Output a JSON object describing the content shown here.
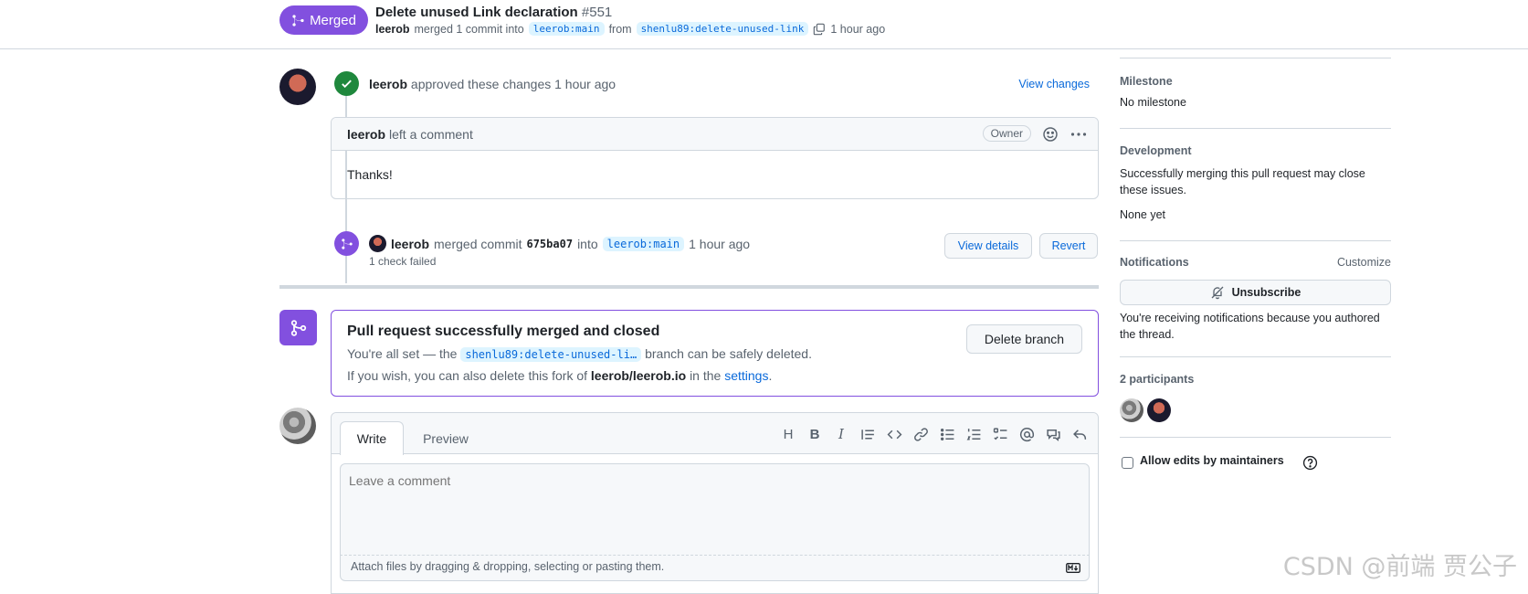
{
  "header": {
    "status": "Merged",
    "title": "Delete unused Link declaration",
    "number": "#551",
    "author": "leerob",
    "merged_text": "merged 1 commit into",
    "base_branch": "leerob:main",
    "from_text": "from",
    "head_branch": "shenlu89:delete-unused-link",
    "time": "1 hour ago"
  },
  "review": {
    "user": "leerob",
    "text": "approved these changes 1 hour ago",
    "view_changes": "View changes"
  },
  "comment": {
    "user": "leerob",
    "action": "left a comment",
    "role": "Owner",
    "body": "Thanks!"
  },
  "merge_event": {
    "user": "leerob",
    "text_a": "merged commit",
    "sha": "675ba07",
    "text_b": "into",
    "branch": "leerob:main",
    "time": "1 hour ago",
    "status": "1 check failed",
    "view_details": "View details",
    "revert": "Revert"
  },
  "merged_box": {
    "title": "Pull request successfully merged and closed",
    "line1_a": "You're all set — the",
    "branch": "shenlu89:delete-unused-li…",
    "line1_b": "branch can be safely deleted.",
    "line2_a": "If you wish, you can also delete this fork of",
    "fork": "leerob/leerob.io",
    "line2_b": "in the",
    "settings_link": "settings",
    "line2_c": ".",
    "delete_branch": "Delete branch"
  },
  "composer": {
    "tab_write": "Write",
    "tab_preview": "Preview",
    "toolbar": [
      "H",
      "B",
      "I",
      "quote-icon",
      "code-icon",
      "link-icon",
      "bulleted-list-icon",
      "numbered-list-icon",
      "task-list-icon",
      "mention-icon",
      "reference-icon",
      "reply-icon"
    ],
    "placeholder": "Leave a comment",
    "attach_text": "Attach files by dragging & dropping, selecting or pasting them."
  },
  "sidebar": {
    "milestone_h": "Milestone",
    "milestone_v": "No milestone",
    "development_h": "Development",
    "development_t": "Successfully merging this pull request may close these issues.",
    "development_v": "None yet",
    "notifications_h": "Notifications",
    "customize": "Customize",
    "unsubscribe": "Unsubscribe",
    "notif_reason": "You're receiving notifications because you authored the thread.",
    "participants_h": "2 participants",
    "allow_edits": "Allow edits by maintainers"
  },
  "watermark": "CSDN @前端 贾公子",
  "colors": {
    "merged": "#8250df",
    "approved": "#1f883d",
    "link": "#0969da",
    "border": "#d0d7de"
  }
}
